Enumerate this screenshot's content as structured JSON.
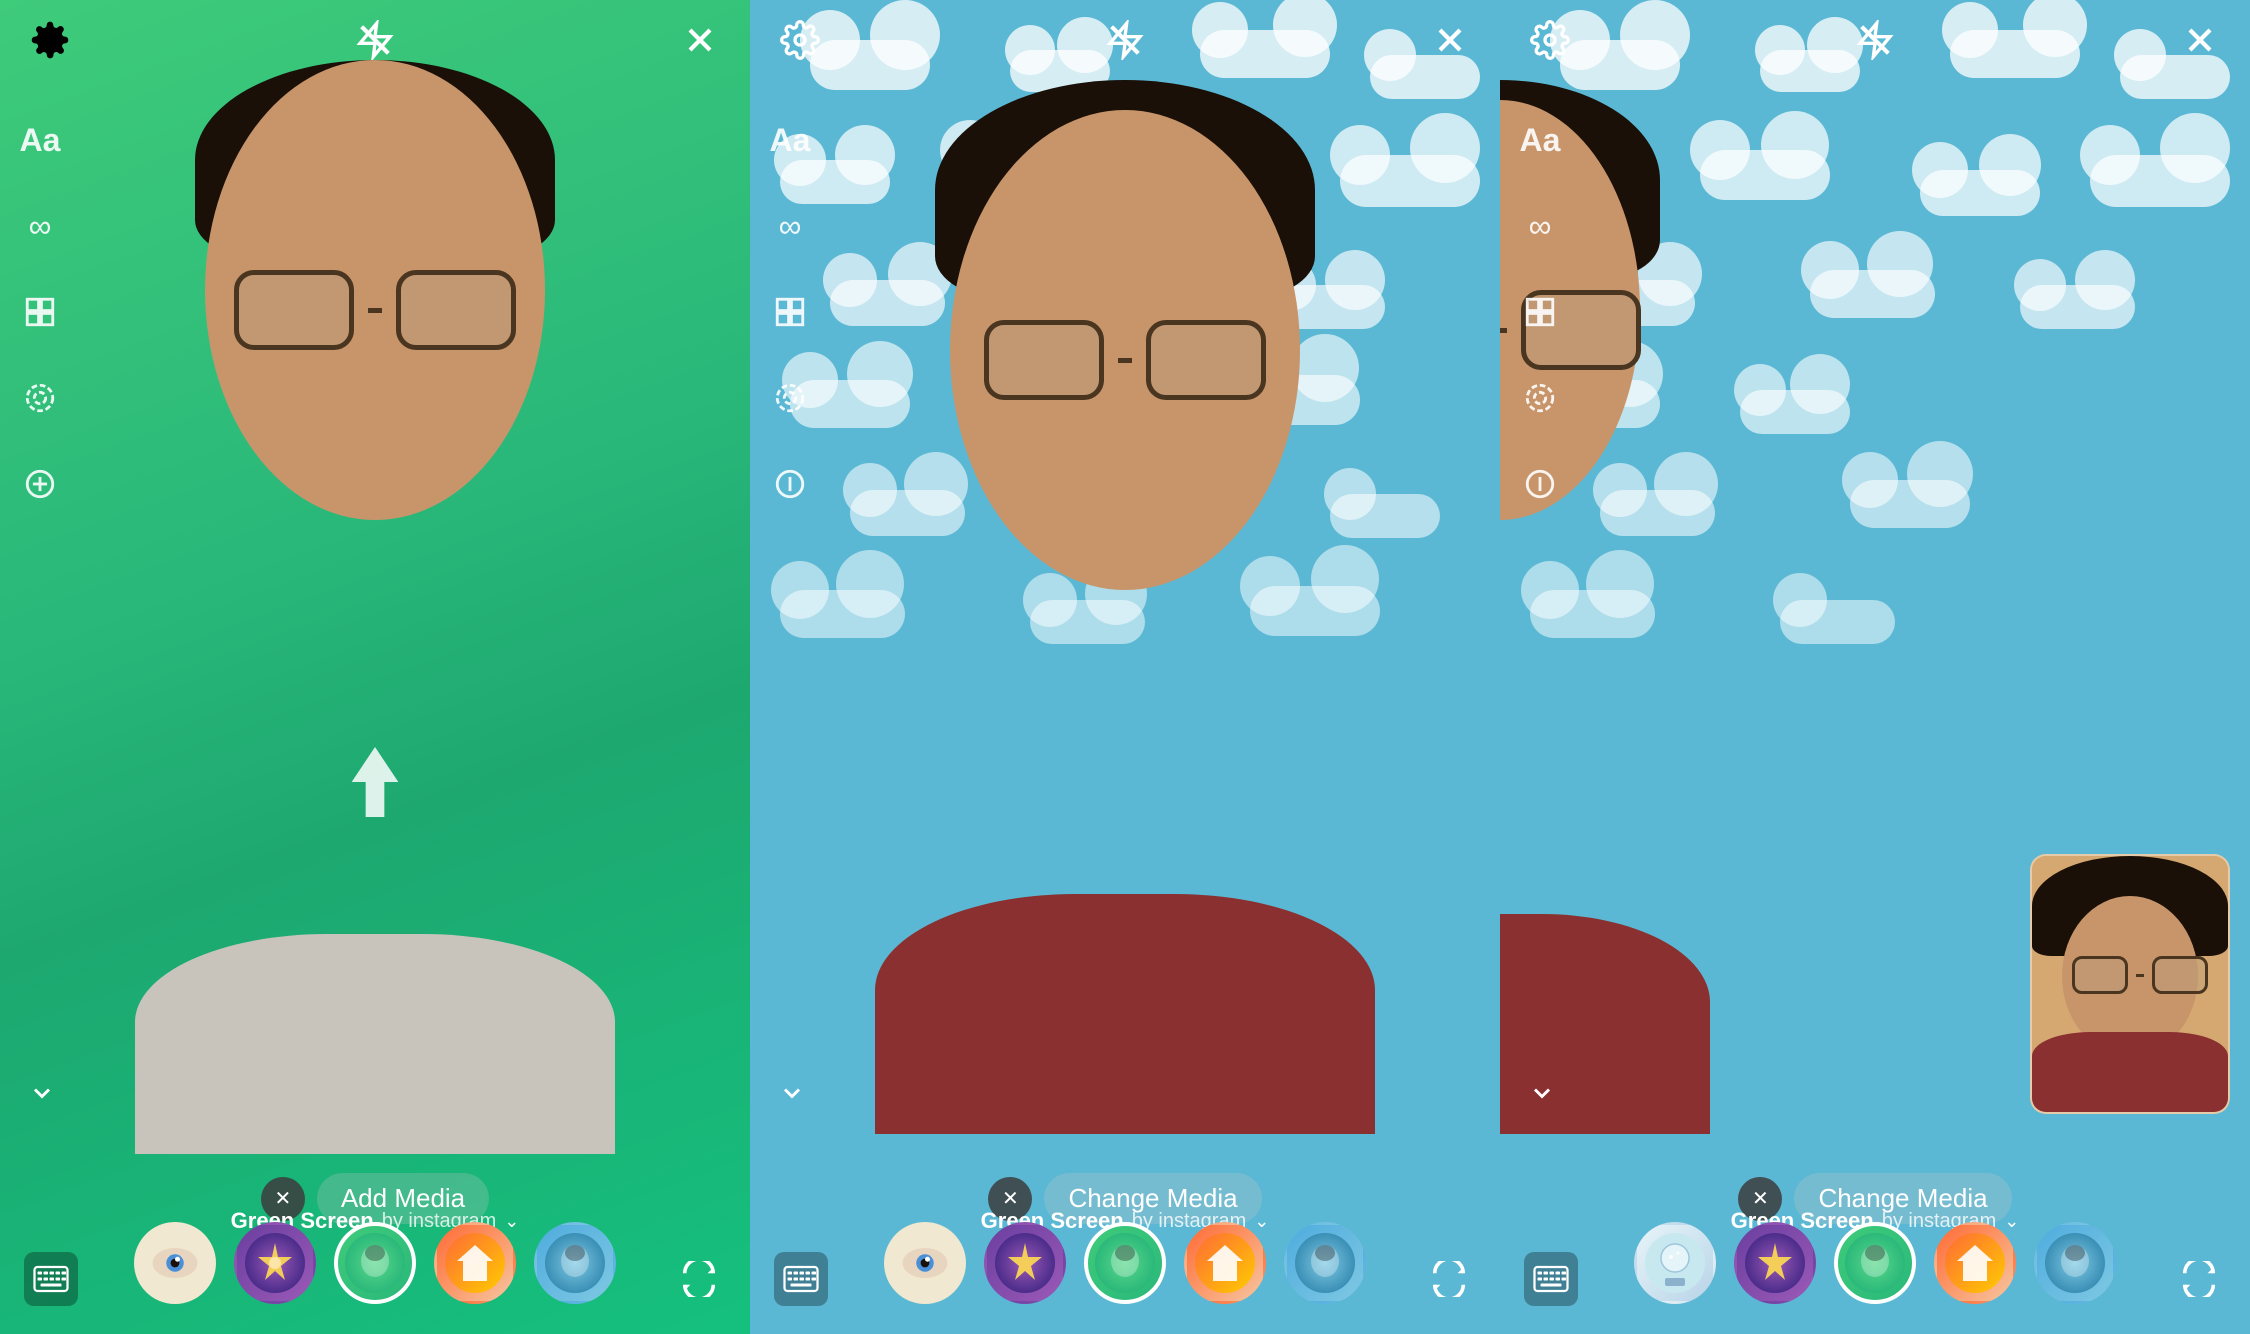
{
  "panels": [
    {
      "id": "panel-1",
      "background": "green",
      "top_icons": {
        "left": "gear",
        "center": "flash-off",
        "right": "close"
      },
      "sidebar_items": [
        "Aa",
        "∞",
        "⊞",
        "◎",
        "⊖"
      ],
      "chevron": "chevron-down",
      "media_button": {
        "show_x": true,
        "label": "Add Media"
      },
      "show_arrow": true,
      "gs_label": "Green Screen",
      "gs_by": "by instagram",
      "filters": [
        "eye",
        "sparkle",
        "green-face",
        "house",
        "blue-face"
      ],
      "bottom_left_icon": "keyboard",
      "bottom_right_icon": "flip-camera"
    },
    {
      "id": "panel-2",
      "background": "sky",
      "top_icons": {
        "left": "gear",
        "center": "flash-off",
        "right": "close"
      },
      "sidebar_items": [
        "Aa",
        "∞",
        "⊞",
        "◎",
        "⊖"
      ],
      "chevron": "chevron-down",
      "media_button": {
        "show_x": true,
        "label": "Change Media"
      },
      "show_arrow": false,
      "gs_label": "Green Screen",
      "gs_by": "by instagram",
      "filters": [
        "eye",
        "sparkle",
        "green-face",
        "house",
        "blue-face"
      ],
      "bottom_left_icon": "keyboard",
      "bottom_right_icon": "flip-camera"
    },
    {
      "id": "panel-3",
      "background": "sky",
      "top_icons": {
        "left": "gear",
        "center": "flash-off",
        "right": "close"
      },
      "sidebar_items": [
        "Aa",
        "∞",
        "⊞",
        "◎",
        "⊖"
      ],
      "chevron": "chevron-down",
      "media_button": {
        "show_x": true,
        "label": "Change Media"
      },
      "show_arrow": false,
      "show_thumb": true,
      "gs_label": "Green Screen",
      "gs_by": "by instagram",
      "filters": [
        "eye",
        "sparkle",
        "green-face",
        "house",
        "blue-face"
      ],
      "bottom_left_icon": "keyboard",
      "bottom_right_icon": "flip-camera"
    }
  ],
  "labels": {
    "add_media": "Add Media",
    "change_media": "Change Media",
    "green_screen": "Green Screen",
    "by_instagram": "by instagram"
  }
}
